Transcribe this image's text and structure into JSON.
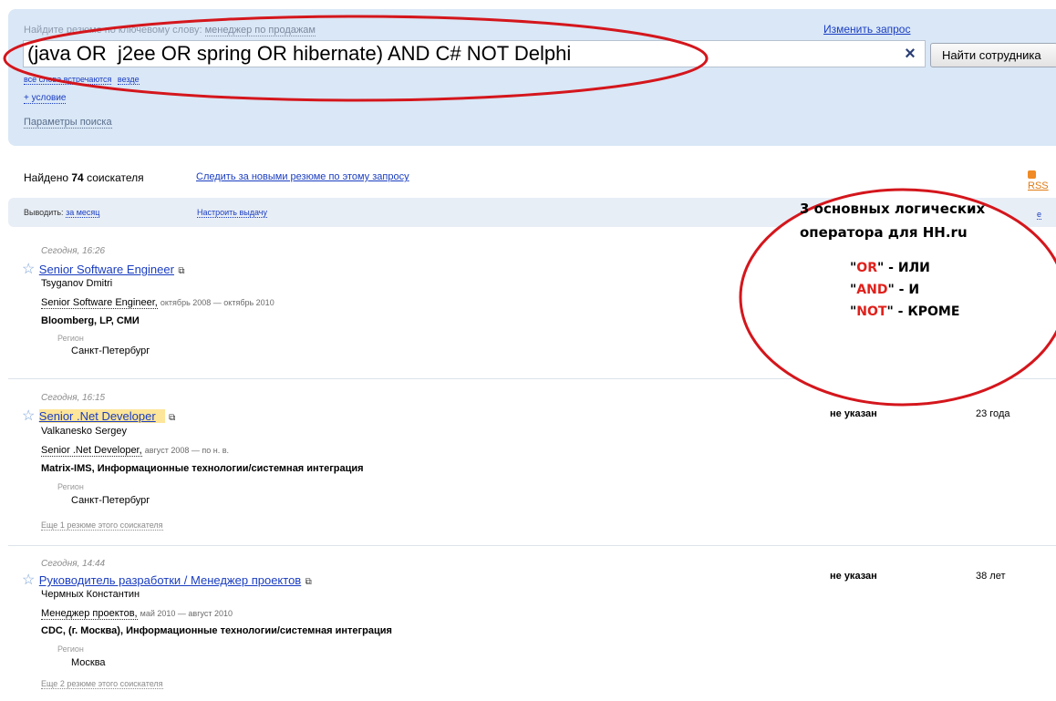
{
  "search": {
    "hint": "Найдите резюме по ключевому слову:",
    "hint_example": "менеджер по продажам",
    "change_query": "Изменить запрос",
    "query": "(java OR  j2ee OR spring OR hibernate) AND C# NOT Delphi",
    "clear_icon": "×",
    "find_button": "Найти сотрудника",
    "words_mode_a": "все слова встречаются",
    "words_mode_b": "везде",
    "add_condition": "+ условие",
    "params": "Параметры поиска"
  },
  "summary": {
    "found_prefix": "Найдено",
    "found_count": "74",
    "found_suffix": "соискателя",
    "follow": "Следить за новыми резюме по этому запросу",
    "rss": "RSS"
  },
  "filter": {
    "output_label": "Выводить:",
    "period": "за месяц",
    "customize": "Настроить выдачу",
    "right_link": "е"
  },
  "results": [
    {
      "date": "Сегодня, 16:26",
      "title": "Senior Software Engineer",
      "name": "Tsyganov Dmitri",
      "position": "Senior Software Engineer,",
      "period": "октябрь 2008 — октябрь 2010",
      "company": "Bloomberg, LP, СМИ",
      "region_label": "Регион",
      "region": "Санкт-Петербург",
      "salary": "",
      "age": "",
      "more": ""
    },
    {
      "date": "Сегодня, 16:15",
      "title": "Senior .Net Developer",
      "name": "Valkanesko Sergey",
      "position": "Senior .Net Developer,",
      "period": "август 2008 — по н. в.",
      "company": "Matrix-IMS, Информационные технологии/системная интеграция",
      "region_label": "Регион",
      "region": "Санкт-Петербург",
      "salary": "не указан",
      "age": "23 года",
      "more": "Еще 1 резюме этого соискателя"
    },
    {
      "date": "Сегодня, 14:44",
      "title": "Руководитель разработки / Менеджер проектов",
      "name": "Чермных Константин",
      "position": "Менеджер проектов,",
      "period": "май 2010 — август 2010",
      "company": "CDC, (г. Москва), Информационные технологии/системная интеграция",
      "region_label": "Регион",
      "region": "Москва",
      "salary": "не указан",
      "age": "38 лет",
      "more": "Еще 2 резюме этого соискателя"
    }
  ],
  "annotation": {
    "title_line1": "3 основных логических",
    "title_line2": "оператора для  HH.ru",
    "operators": [
      {
        "quote_open": "\"",
        "op": "OR",
        "quote_close": "\"",
        "meaning": " - ИЛИ"
      },
      {
        "quote_open": "\"",
        "op": "AND",
        "quote_close": "\"",
        "meaning": " - И"
      },
      {
        "quote_open": "\"",
        "op": "NOT",
        "quote_close": "\"",
        "meaning": " - КРОМЕ"
      }
    ],
    "accent_color": "#e0201b",
    "oval_color": "#d4161c"
  }
}
